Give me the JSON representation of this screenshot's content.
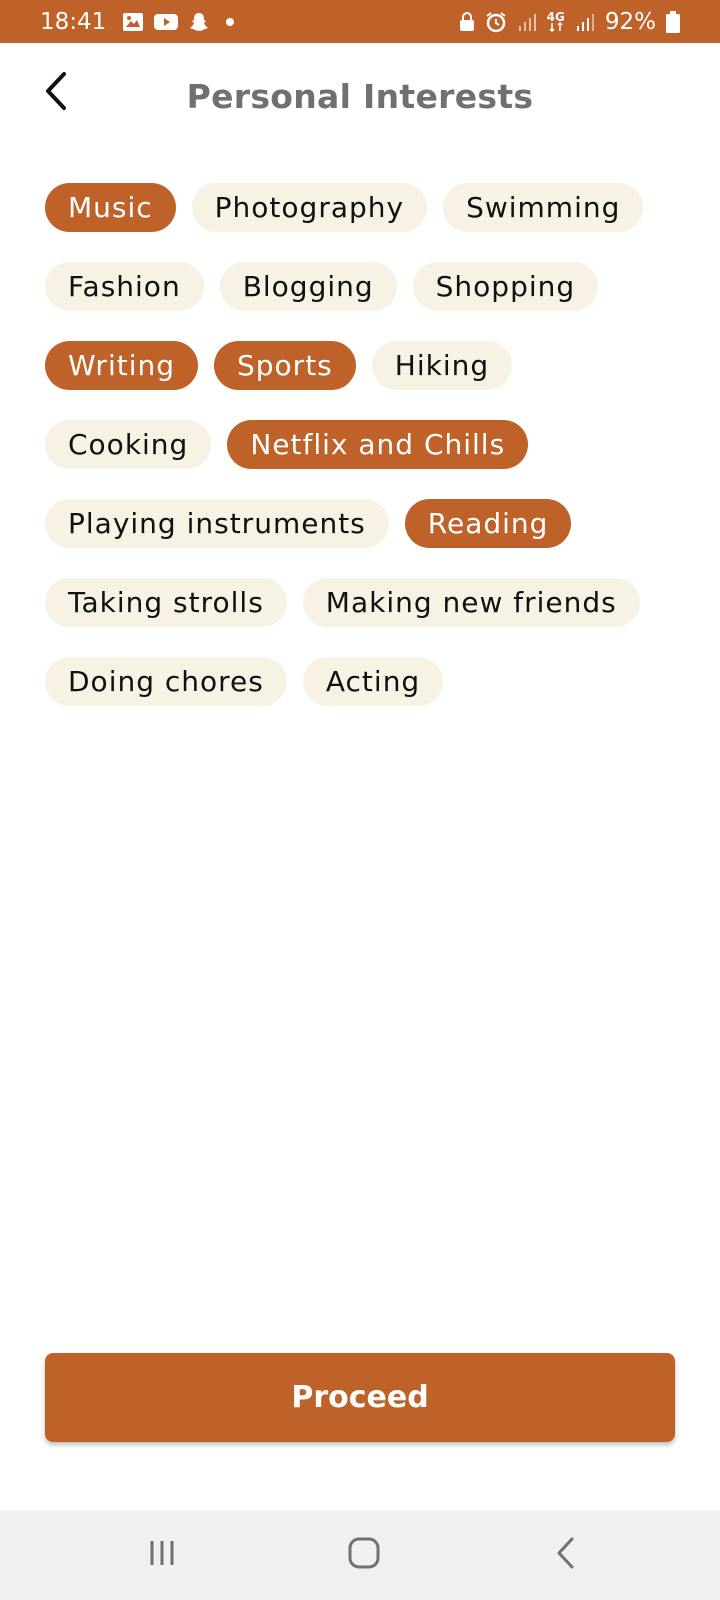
{
  "status_bar": {
    "time": "18:41",
    "battery": "92%",
    "icons_left": [
      "gallery-icon",
      "youtube-icon",
      "snapchat-icon",
      "notification-dot-icon"
    ],
    "icons_right": [
      "lock-icon",
      "alarm-icon",
      "signal-icon",
      "4g-icon",
      "signal-icon",
      "battery-icon"
    ],
    "network": "4G",
    "background_color": "#BF6229"
  },
  "header": {
    "title": "Personal Interests",
    "back_icon": "chevron-left-icon"
  },
  "interests": [
    {
      "label": "Music",
      "selected": true
    },
    {
      "label": "Photography",
      "selected": false
    },
    {
      "label": "Swimming",
      "selected": false
    },
    {
      "label": "Fashion",
      "selected": false
    },
    {
      "label": "Blogging",
      "selected": false
    },
    {
      "label": "Shopping",
      "selected": false
    },
    {
      "label": "Writing",
      "selected": true
    },
    {
      "label": "Sports",
      "selected": true
    },
    {
      "label": "Hiking",
      "selected": false
    },
    {
      "label": "Cooking",
      "selected": false
    },
    {
      "label": "Netflix and Chills",
      "selected": true
    },
    {
      "label": "Playing instruments",
      "selected": false
    },
    {
      "label": "Reading",
      "selected": true
    },
    {
      "label": "Taking strolls",
      "selected": false
    },
    {
      "label": "Making new friends",
      "selected": false
    },
    {
      "label": "Doing chores",
      "selected": false
    },
    {
      "label": "Acting",
      "selected": false
    }
  ],
  "proceed_button": {
    "label": "Proceed"
  },
  "colors": {
    "accent": "#BF6229",
    "chip_unselected_bg": "#F8F2E4",
    "title_text": "#707070"
  },
  "nav_bar": {
    "buttons": [
      "recent-apps-icon",
      "home-icon",
      "back-icon"
    ]
  }
}
